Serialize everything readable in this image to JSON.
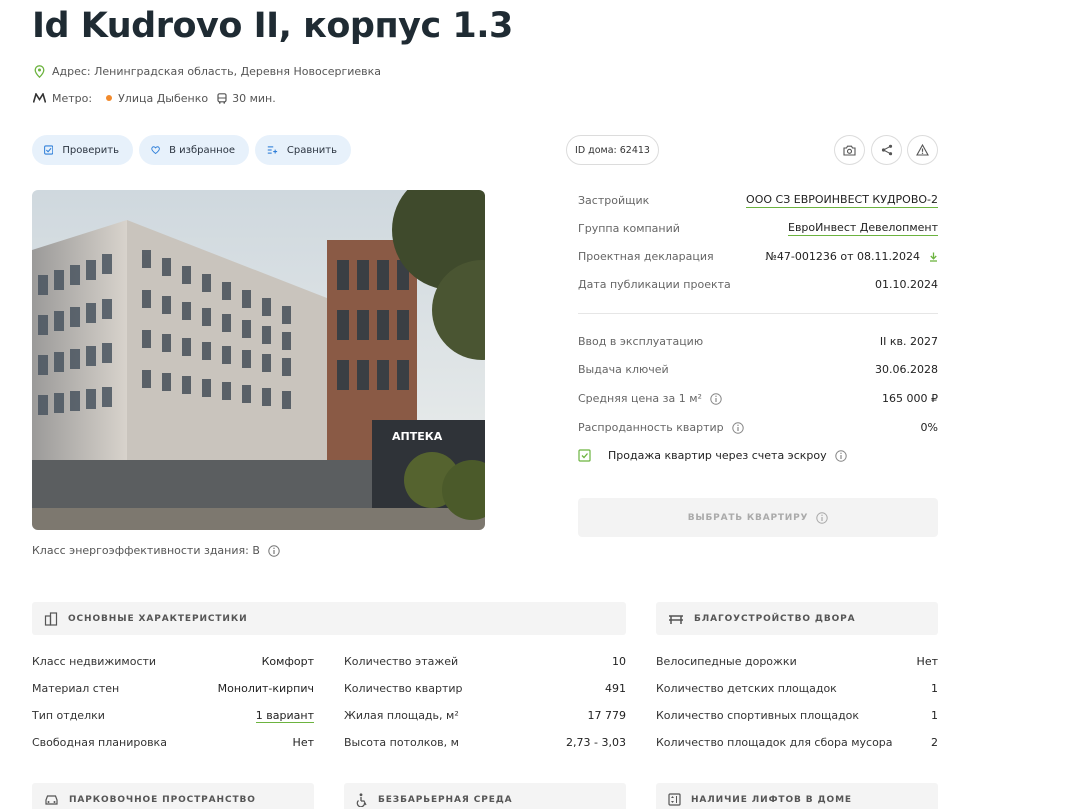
{
  "header": {
    "title": "Id Kudrovo II, корпус 1.3",
    "address": "Адрес: Ленинградская область, Деревня Новосергиевка",
    "metro_label": "Метро:",
    "metro_station": "Улица Дыбенко",
    "metro_time": "30 мин."
  },
  "actions": {
    "check": "Проверить",
    "favorite": "В избранное",
    "compare": "Сравнить",
    "house_id": "ID дома: 62413"
  },
  "photo": {
    "sign": "АПТЕКА"
  },
  "energy": "Класс энергоэффективности здания: B",
  "info": {
    "developer_label": "Застройщик",
    "developer_value": "ООО СЗ ЕВРОИНВЕСТ КУДРОВО-2",
    "group_label": "Группа компаний",
    "group_value": "ЕвроИнвест Девелопмент",
    "declaration_label": "Проектная декларация",
    "declaration_value": "№47-001236 от 08.11.2024",
    "pub_label": "Дата публикации проекта",
    "pub_value": "01.10.2024",
    "commission_label": "Ввод в эксплуатацию",
    "commission_value": "II кв. 2027",
    "keys_label": "Выдача ключей",
    "keys_value": "30.06.2028",
    "price_label": "Средняя цена за 1 м²",
    "price_value": "165 000 ₽",
    "sold_label": "Распроданность квартир",
    "sold_value": "0%",
    "escrow": "Продажа квартир через счета эскроу",
    "choose_button": "ВЫБРАТЬ КВАРТИРУ"
  },
  "sections": {
    "main": "ОСНОВНЫЕ ХАРАКТЕРИСТИКИ",
    "yard": "БЛАГОУСТРОЙСТВО ДВОРА",
    "parking": "ПАРКОВОЧНОЕ ПРОСТРАНСТВО",
    "barrier": "БЕЗБАРЬЕРНАЯ СРЕДА",
    "lifts": "НАЛИЧИЕ ЛИФТОВ В ДОМЕ"
  },
  "specs": {
    "col1": [
      {
        "k": "Класс недвижимости",
        "v": "Комфорт"
      },
      {
        "k": "Материал стен",
        "v": "Монолит-кирпич"
      },
      {
        "k": "Тип отделки",
        "v": "1 вариант"
      },
      {
        "k": "Свободная планировка",
        "v": "Нет"
      }
    ],
    "col2": [
      {
        "k": "Количество этажей",
        "v": "10"
      },
      {
        "k": "Количество квартир",
        "v": "491"
      },
      {
        "k": "Жилая площадь, м²",
        "v": "17 779"
      },
      {
        "k": "Высота потолков, м",
        "v": "2,73 - 3,03"
      }
    ],
    "col3": [
      {
        "k": "Велосипедные дорожки",
        "v": "Нет"
      },
      {
        "k": "Количество детских площадок",
        "v": "1"
      },
      {
        "k": "Количество спортивных площадок",
        "v": "1"
      },
      {
        "k": "Количество площадок для сбора мусора",
        "v": "2"
      }
    ]
  }
}
